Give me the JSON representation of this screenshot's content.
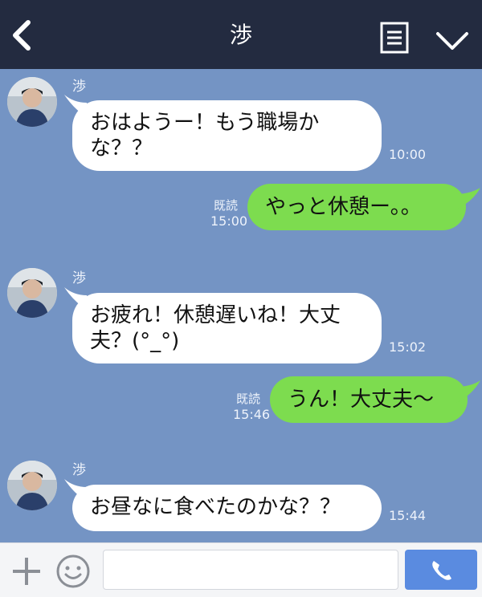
{
  "header": {
    "title": "渉",
    "back_icon": "chevron-left-icon",
    "menu_icon": "list-menu-icon",
    "collapse_icon": "chevron-down-icon"
  },
  "messages": [
    {
      "direction": "in",
      "sender": "渉",
      "text": "おはようー！もう職場かな？？",
      "time": "10:00"
    },
    {
      "direction": "out",
      "read": "既読",
      "text": "やっと休憩ー。。",
      "time": "15:00"
    },
    {
      "direction": "in",
      "sender": "渉",
      "text": "お疲れ！休憩遅いね！大丈夫？(°_°)",
      "time": "15:02"
    },
    {
      "direction": "out",
      "read": "既読",
      "text": "うん！大丈夫〜",
      "time": "15:46"
    },
    {
      "direction": "in",
      "sender": "渉",
      "text": "お昼なに食べたのかな？？",
      "time": "15:44"
    }
  ],
  "footer": {
    "input_value": "",
    "plus_icon": "plus-icon",
    "emoji_icon": "smiley-icon",
    "call_icon": "phone-icon"
  },
  "colors": {
    "header_bg": "#232b40",
    "chat_bg": "#7494c4",
    "incoming_bubble": "#ffffff",
    "outgoing_bubble": "#7ddc4f",
    "call_button": "#5a8be0"
  }
}
